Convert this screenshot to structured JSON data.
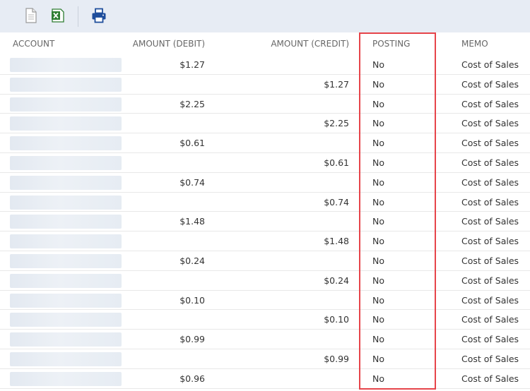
{
  "toolbar": {
    "buttons": [
      {
        "icon": "document-icon"
      },
      {
        "icon": "excel-export-icon"
      },
      {
        "icon": "print-icon"
      }
    ]
  },
  "columns": {
    "account": "ACCOUNT",
    "debit": "AMOUNT (DEBIT)",
    "credit": "AMOUNT (CREDIT)",
    "posting": "POSTING",
    "memo": "MEMO"
  },
  "rows": [
    {
      "debit": "$1.27",
      "credit": "",
      "posting": "No",
      "memo": "Cost of Sales"
    },
    {
      "debit": "",
      "credit": "$1.27",
      "posting": "No",
      "memo": "Cost of Sales"
    },
    {
      "debit": "$2.25",
      "credit": "",
      "posting": "No",
      "memo": "Cost of Sales"
    },
    {
      "debit": "",
      "credit": "$2.25",
      "posting": "No",
      "memo": "Cost of Sales"
    },
    {
      "debit": "$0.61",
      "credit": "",
      "posting": "No",
      "memo": "Cost of Sales"
    },
    {
      "debit": "",
      "credit": "$0.61",
      "posting": "No",
      "memo": "Cost of Sales"
    },
    {
      "debit": "$0.74",
      "credit": "",
      "posting": "No",
      "memo": "Cost of Sales"
    },
    {
      "debit": "",
      "credit": "$0.74",
      "posting": "No",
      "memo": "Cost of Sales"
    },
    {
      "debit": "$1.48",
      "credit": "",
      "posting": "No",
      "memo": "Cost of Sales"
    },
    {
      "debit": "",
      "credit": "$1.48",
      "posting": "No",
      "memo": "Cost of Sales"
    },
    {
      "debit": "$0.24",
      "credit": "",
      "posting": "No",
      "memo": "Cost of Sales"
    },
    {
      "debit": "",
      "credit": "$0.24",
      "posting": "No",
      "memo": "Cost of Sales"
    },
    {
      "debit": "$0.10",
      "credit": "",
      "posting": "No",
      "memo": "Cost of Sales"
    },
    {
      "debit": "",
      "credit": "$0.10",
      "posting": "No",
      "memo": "Cost of Sales"
    },
    {
      "debit": "$0.99",
      "credit": "",
      "posting": "No",
      "memo": "Cost of Sales"
    },
    {
      "debit": "",
      "credit": "$0.99",
      "posting": "No",
      "memo": "Cost of Sales"
    },
    {
      "debit": "$0.96",
      "credit": "",
      "posting": "No",
      "memo": "Cost of Sales"
    }
  ],
  "highlight": {
    "color": "#e6444a",
    "column": "POSTING"
  }
}
